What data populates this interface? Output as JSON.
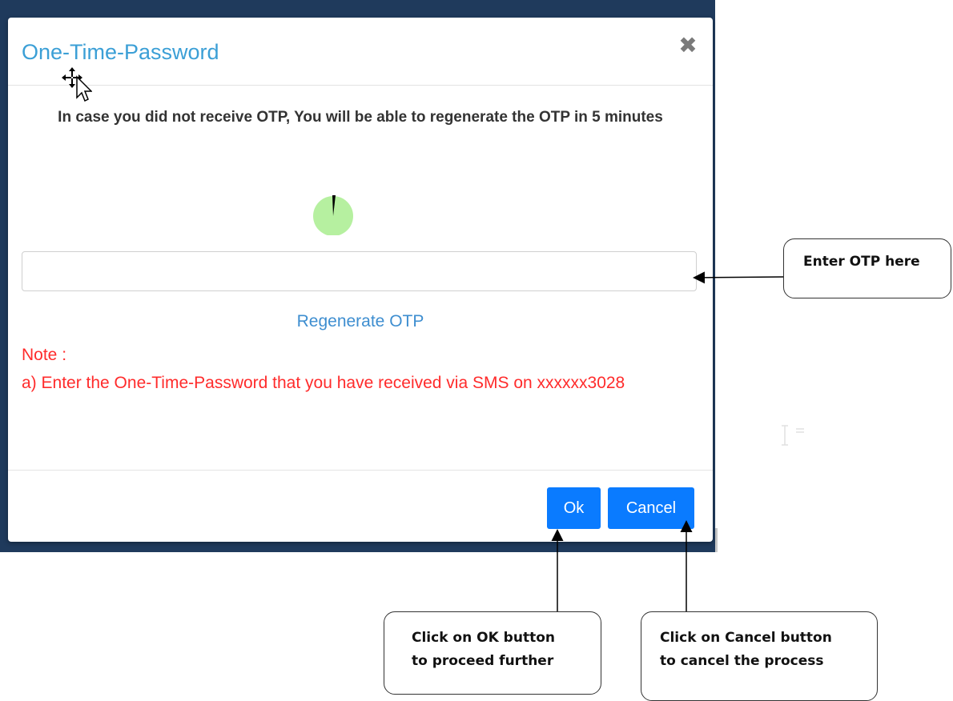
{
  "modal": {
    "title": "One-Time-Password",
    "close_symbol": "✖",
    "info_text": "In case you did not receive OTP, You will be able to regenerate the OTP in 5 minutes",
    "otp_input": {
      "value": "",
      "placeholder": ""
    },
    "regenerate_link": "Regenerate OTP",
    "note": {
      "heading": "Note :",
      "line_a": "a) Enter the One-Time-Password that you have received via SMS on xxxxxx3028"
    },
    "buttons": {
      "ok": "Ok",
      "cancel": "Cancel"
    },
    "colors": {
      "title": "#3b9fd6",
      "note": "#ff2b2b",
      "button": "#0a7bff",
      "timer_fill": "#b6f0a0"
    },
    "icons": [
      "close-icon",
      "move-cursor-icon",
      "timer-icon"
    ]
  },
  "callouts": {
    "otp": "Enter OTP here",
    "ok_line1": "Click on OK button",
    "ok_line2": "to proceed further",
    "cancel_line1": "Click on Cancel button",
    "cancel_line2": "to cancel the process"
  }
}
